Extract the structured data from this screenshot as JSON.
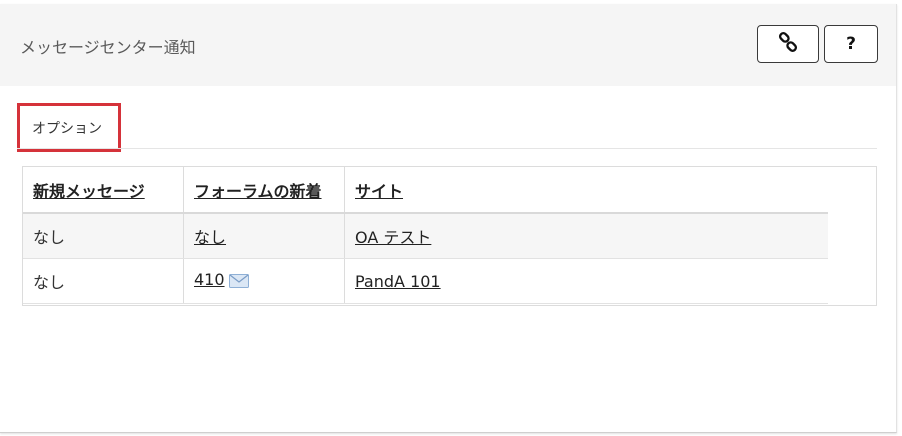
{
  "header": {
    "title": "メッセージセンター通知",
    "help_label": "?"
  },
  "options": {
    "label": "オプション"
  },
  "table": {
    "columns": [
      "新規メッセージ",
      "フォーラムの新着",
      "サイト"
    ],
    "rows": [
      {
        "messages": "なし",
        "forums": "なし",
        "site": "OA テスト"
      },
      {
        "messages": "なし",
        "forums": "410",
        "site": "PandA 101"
      }
    ]
  },
  "icons": {
    "link": "link-icon",
    "envelope": "envelope-icon"
  },
  "colors": {
    "highlight_border": "#d5323a",
    "header_bg": "#f5f5f5"
  }
}
